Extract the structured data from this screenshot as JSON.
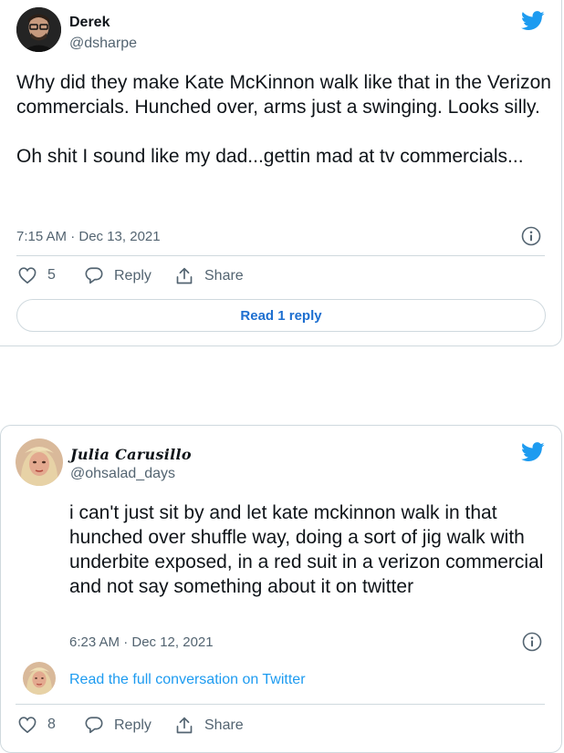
{
  "tweets": [
    {
      "author_name": "Derek",
      "author_handle": "@dsharpe",
      "text": "Why did they make Kate McKinnon walk like that in the Verizon commercials. Hunched over, arms just a swinging. Looks silly.\n\nOh shit I sound like my dad...gettin mad at tv commercials...",
      "timestamp": "7:15 AM · Dec 13, 2021",
      "like_count": "5",
      "reply_label": "Reply",
      "share_label": "Share",
      "read_replies_label": "Read 1 reply"
    },
    {
      "author_name": "Julia Carusillo",
      "author_handle": "@ohsalad_days",
      "text": "i can't just sit by and let kate mckinnon walk in that hunched over shuffle way, doing a sort of jig walk with underbite exposed, in a red suit in a verizon commercial and not say something about it on twitter",
      "timestamp": "6:23 AM · Dec 12, 2021",
      "conversation_link": "Read the full conversation on Twitter",
      "like_count": "8",
      "reply_label": "Reply",
      "share_label": "Share"
    }
  ],
  "colors": {
    "twitter_blue": "#1d9bf0",
    "text_primary": "#0f1419",
    "text_secondary": "#536471",
    "border": "#cfd9de"
  },
  "icons": [
    "twitter-bird-icon",
    "info-icon",
    "heart-icon",
    "reply-icon",
    "share-icon"
  ]
}
